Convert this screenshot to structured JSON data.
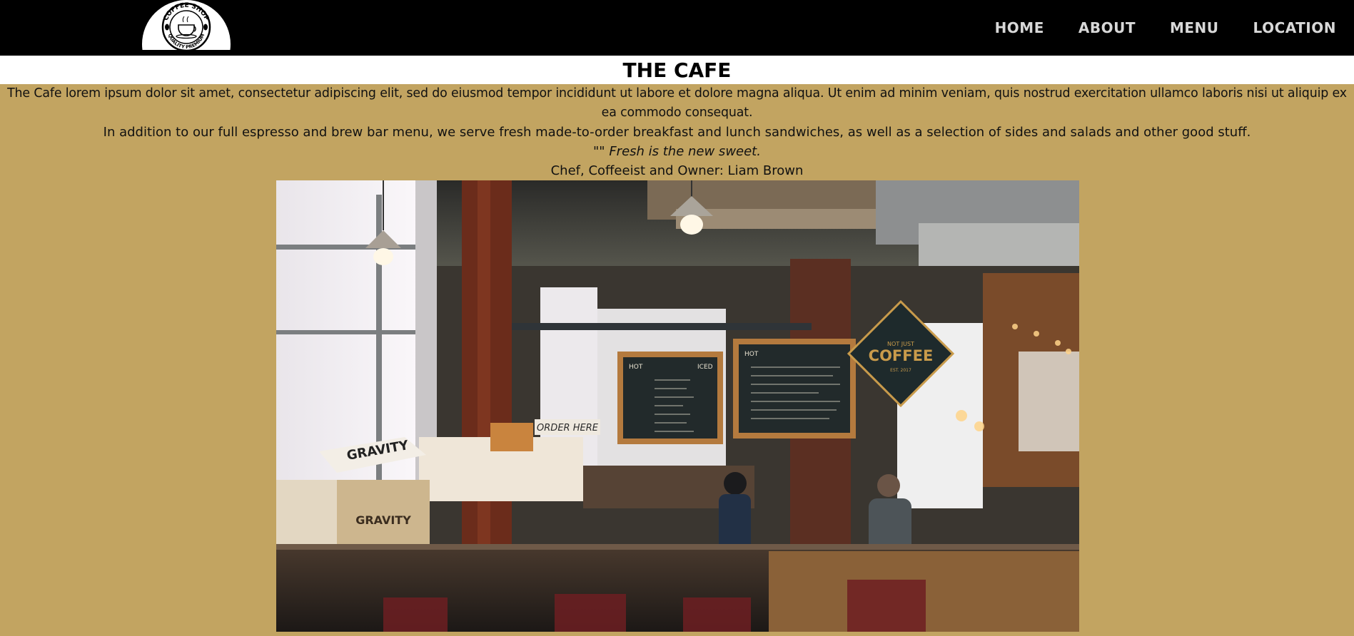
{
  "logo": {
    "top_text": "COFFEE SHOP",
    "bottom_text": "QUALITY PREMIUM"
  },
  "nav": {
    "items": [
      "HOME",
      "ABOUT",
      "MENU",
      "LOCATION"
    ]
  },
  "page": {
    "title": "THE CAFE"
  },
  "content": {
    "intro": "The Cafe lorem ipsum dolor sit amet, consectetur adipiscing elit, sed do eiusmod tempor incididunt ut labore et dolore magna aliqua. Ut enim ad minim veniam, quis nostrud exercitation ullamco laboris nisi ut aliquip ex ea commodo consequat.",
    "menu_text": "In addition to our full espresso and brew bar menu, we serve fresh made-to-order breakfast and lunch sandwiches, as well as a selection of sides and salads and other good stuff.",
    "quote_marks": "\"\"",
    "quote": "Fresh is the new sweet.",
    "attribution": "Chef, Coffeeist and Owner: Liam Brown"
  },
  "photo": {
    "chalkboard_left": "HOT",
    "chalkboard_left_right": "ICED",
    "chalkboard_right": "HOT",
    "sign_top": "NOT JUST",
    "sign_main": "COFFEE",
    "sign_bottom": "EST. 2017",
    "order_sign": "ORDER HERE",
    "crate_label": "GRAVITY"
  },
  "colors": {
    "nav_bg": "#000000",
    "page_bg": "#c2a461",
    "title_bg": "#ffffff"
  }
}
